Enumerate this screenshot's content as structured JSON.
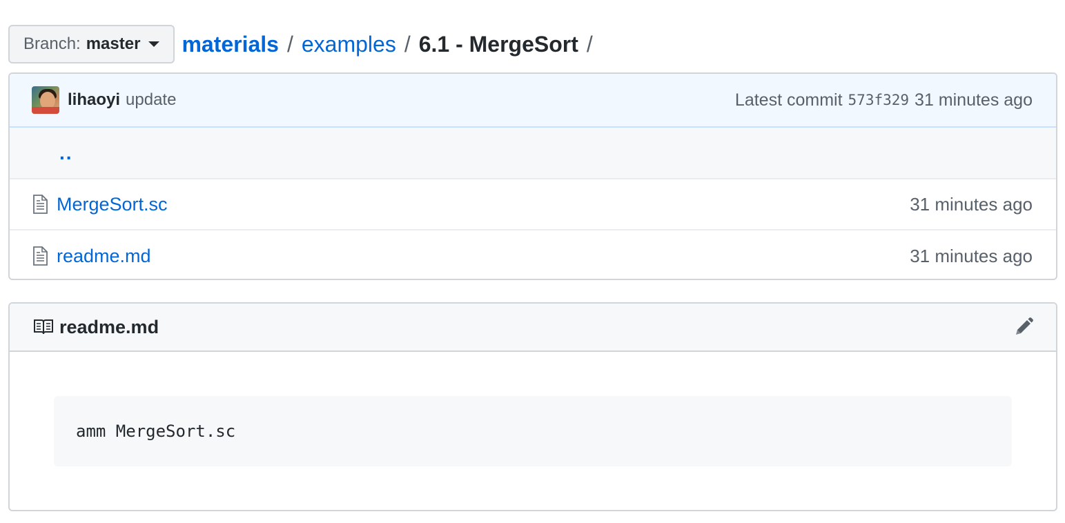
{
  "branch": {
    "prefix": "Branch:",
    "name": "master"
  },
  "breadcrumb": {
    "items": [
      "materials",
      "examples"
    ],
    "separator": "/",
    "current": "6.1 - MergeSort",
    "trailing": "/"
  },
  "commit": {
    "author": "lihaoyi",
    "message": "update",
    "latest_label": "Latest commit",
    "sha": "573f329",
    "age": "31 minutes ago"
  },
  "files": {
    "parent": "..",
    "rows": [
      {
        "name": "MergeSort.sc",
        "age": "31 minutes ago",
        "icon": "file-icon"
      },
      {
        "name": "readme.md",
        "age": "31 minutes ago",
        "icon": "file-icon"
      }
    ]
  },
  "readme": {
    "title": "readme.md",
    "icon": "book-icon",
    "edit_icon": "pencil-icon",
    "code": "amm MergeSort.sc"
  },
  "colors": {
    "link": "#0366d6",
    "muted": "#586069",
    "commit_bg": "#f1f8ff",
    "row_alt_bg": "#f6f8fa",
    "border": "#d1d5da"
  }
}
